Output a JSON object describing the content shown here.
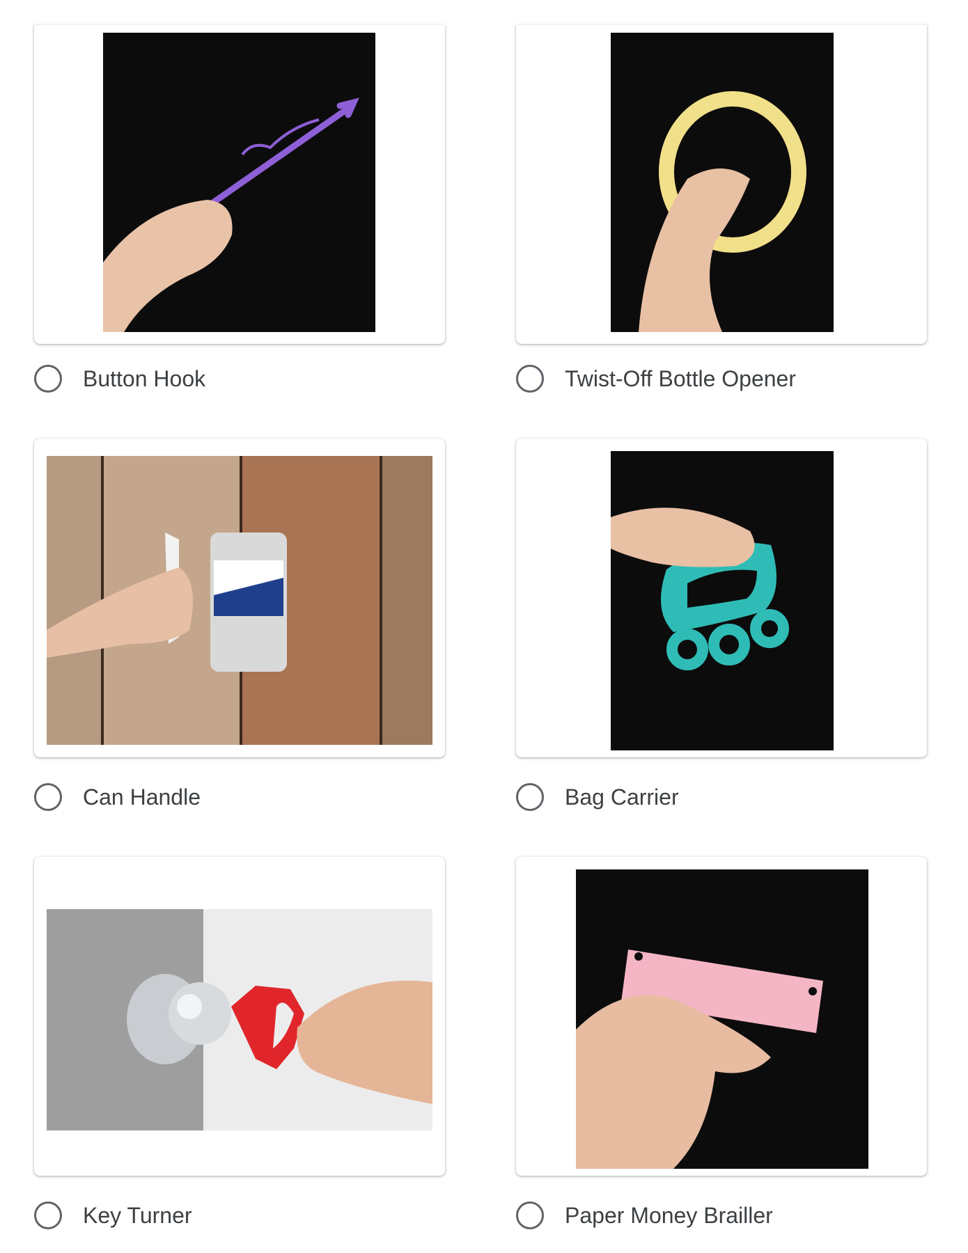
{
  "options": [
    {
      "label": "Button Hook",
      "selected": false,
      "image": "button-hook-photo"
    },
    {
      "label": "Twist-Off Bottle Opener",
      "selected": false,
      "image": "bottle-opener-photo"
    },
    {
      "label": "Can Handle",
      "selected": false,
      "image": "can-handle-photo"
    },
    {
      "label": "Bag Carrier",
      "selected": false,
      "image": "bag-carrier-photo"
    },
    {
      "label": "Key Turner",
      "selected": false,
      "image": "key-turner-photo"
    },
    {
      "label": "Paper Money Brailler",
      "selected": false,
      "image": "money-brailler-photo"
    }
  ],
  "colors": {
    "radio_border": "#5f6368",
    "label_text": "#3c4043",
    "photo_background_dark": "#0e0e0e"
  }
}
